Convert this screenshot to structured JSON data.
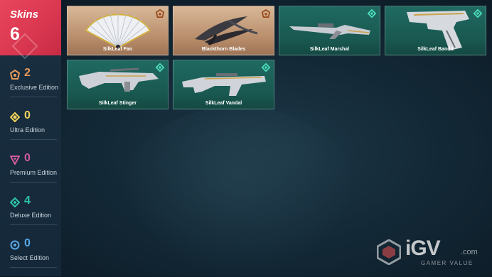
{
  "sidebar": {
    "title": "Skins",
    "count": "6",
    "editions": [
      {
        "count": "2",
        "label": "Exclusive Edition",
        "color": "#e89a5a",
        "icon": "exclusive-edition-icon"
      },
      {
        "count": "0",
        "label": "Ultra Edition",
        "color": "#f2d35a",
        "icon": "ultra-edition-icon"
      },
      {
        "count": "0",
        "label": "Premium Edition",
        "color": "#d35aa0",
        "icon": "premium-edition-icon"
      },
      {
        "count": "4",
        "label": "Deluxe Edition",
        "color": "#2ec6a8",
        "icon": "deluxe-edition-icon"
      },
      {
        "count": "0",
        "label": "Select Edition",
        "color": "#5aa8e8",
        "icon": "select-edition-icon"
      }
    ]
  },
  "skins": [
    {
      "name": "SilkLeaf Fan",
      "edition": "exclusive"
    },
    {
      "name": "Blackthorn Blades",
      "edition": "exclusive"
    },
    {
      "name": "SilkLeaf Marshal",
      "edition": "deluxe"
    },
    {
      "name": "SilkLeaf Bandit",
      "edition": "deluxe"
    },
    {
      "name": "SilkLeaf Stinger",
      "edition": "deluxe"
    },
    {
      "name": "SilkLeaf Vandal",
      "edition": "deluxe"
    }
  ],
  "watermark": {
    "brand": "iGV",
    "suffix": ".com",
    "tagline": "GAMER VALUE"
  },
  "colors": {
    "accent_red": "#e0405a",
    "sidebar_bg": "#17293a",
    "deluxe_card": "#1d6660",
    "exclusive_card": "#c9a07e"
  }
}
